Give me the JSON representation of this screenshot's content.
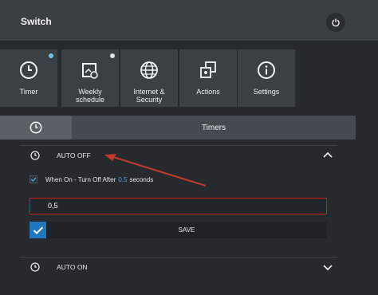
{
  "header": {
    "title": "Switch",
    "power_icon": "power-icon"
  },
  "tiles": [
    {
      "label": "Timer",
      "icon": "clock-icon",
      "badge_color": "#6ec6f0"
    },
    {
      "label": "Weekly\nschedule",
      "icon": "calendar-schedule-icon",
      "badge_color": "#dfe3e6"
    },
    {
      "label": "Internet &\nSecurity",
      "icon": "globe-icon"
    },
    {
      "label": "Actions",
      "icon": "actions-icon"
    },
    {
      "label": "Settings",
      "icon": "info-icon"
    }
  ],
  "tabs": {
    "icon": "clock-icon",
    "label": "Timers"
  },
  "auto_off": {
    "label": "AUTO OFF",
    "checkbox_prefix": "When On - Turn Off After",
    "checkbox_value": "0.5",
    "checkbox_suffix": "seconds",
    "input_value": "0,5",
    "save_label": "SAVE"
  },
  "auto_on": {
    "label": "AUTO ON"
  },
  "colors": {
    "accent": "#1f77c0",
    "highlight": "#d11a1a",
    "link": "#4fa6e0"
  }
}
